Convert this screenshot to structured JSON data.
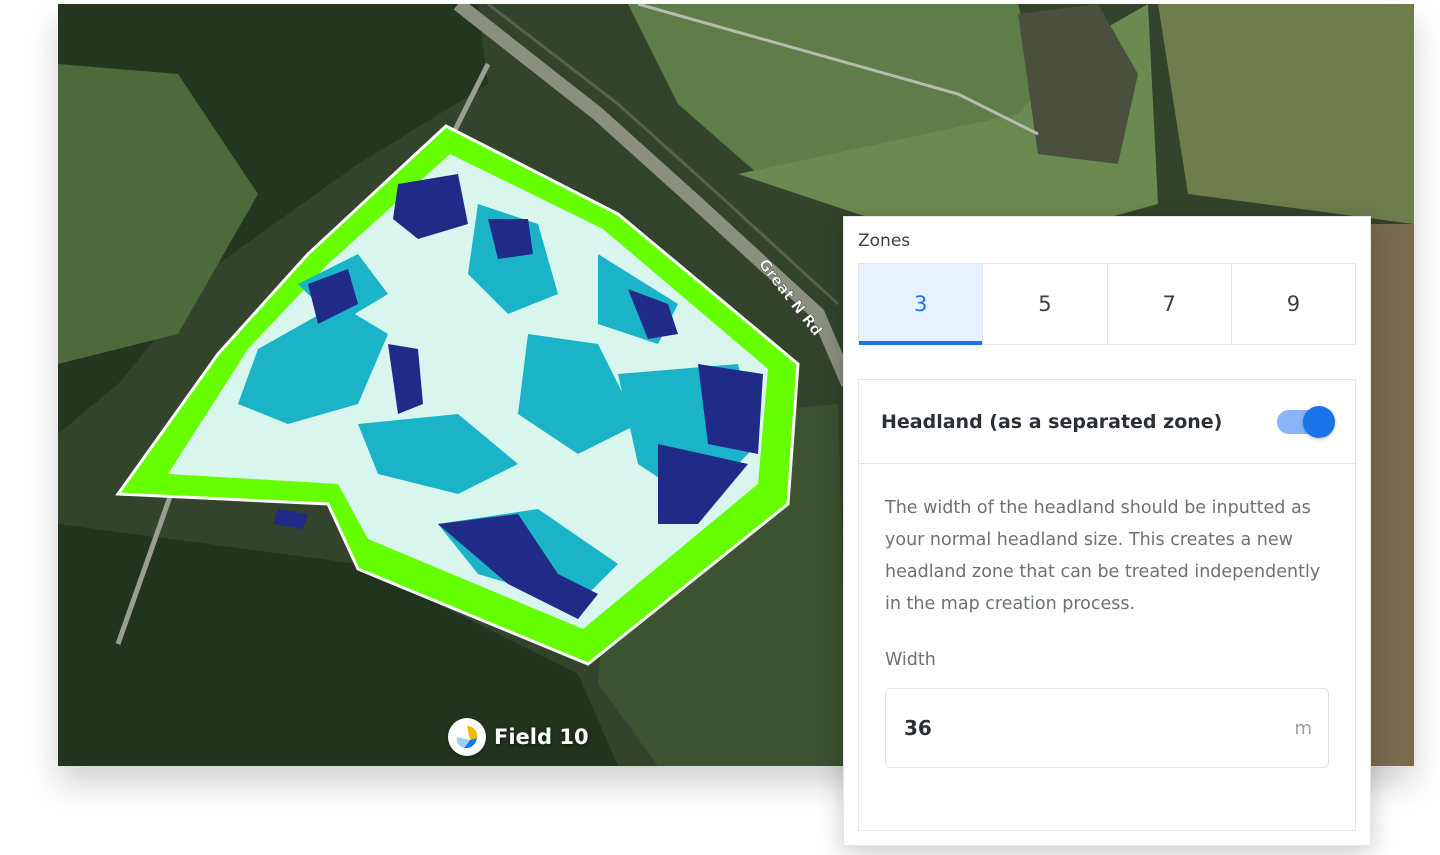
{
  "map": {
    "field_name": "Field 10",
    "road_label": "Great N Rd",
    "zone_colors": {
      "boundary": "#66ff00",
      "light": "#d8f6ee",
      "mid": "#1ab3c8",
      "dark": "#1f2b86"
    },
    "logo_icon": "field-logo-icon"
  },
  "panel": {
    "zones_label": "Zones",
    "zone_options": [
      "3",
      "5",
      "7",
      "9"
    ],
    "selected_zone": "3",
    "headland_title": "Headland (as a separated zone)",
    "headland_enabled": true,
    "description": "The width of the headland should be inputted as your normal headland size. This creates a new headland zone that can be treated independently in the map creation process.",
    "width_label": "Width",
    "width_value": "36",
    "width_unit": "m",
    "accent_color": "#1a73e8"
  }
}
